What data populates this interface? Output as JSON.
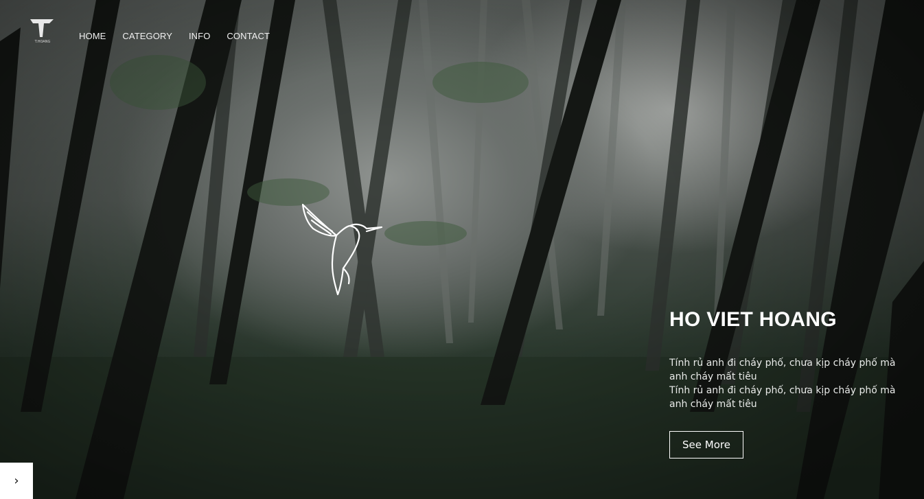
{
  "brand": {
    "logo_letter": "T",
    "logo_caption": "T.HOANG",
    "icon": "logo-t-icon"
  },
  "nav": [
    {
      "label": "HOME"
    },
    {
      "label": "CATEGORY"
    },
    {
      "label": "INFO"
    },
    {
      "label": "CONTACT"
    }
  ],
  "hero": {
    "decoration_icon": "hummingbird-icon",
    "title": "HO VIET HOANG",
    "paragraphs": [
      "Tính rủ anh đi cháy phố, chưa kịp cháy phố mà anh cháy mất tiêu",
      "Tính rủ anh đi cháy phố, chưa kịp cháy phố mà anh cháy mất tiêu"
    ],
    "cta_label": "See More"
  },
  "slider": {
    "next_icon": "chevron-right-icon",
    "next_glyph": "›"
  },
  "colors": {
    "text": "#ffffff",
    "overlay": "#2a302d",
    "button_bg": "#ffffff"
  }
}
